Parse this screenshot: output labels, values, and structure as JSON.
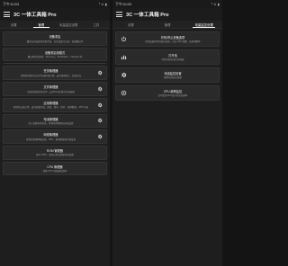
{
  "left": {
    "status": {
      "time": "下午10:53",
      "right": "⁰ ⊙ ▮"
    },
    "app_title": "3C 一体工具箱 Pro",
    "tabs": [
      "设置",
      "管理",
      "电量监控设置",
      "工具"
    ],
    "cards": [
      {
        "title": "设备重启",
        "desc": "重新启动设备并还原系统，包括设备冷启动、强制重启等"
      },
      {
        "title": "设备重启到模式",
        "desc": "重启到指定模式：Recovery、Bootloader、Fastboot 等"
      },
      {
        "title": "任务管理器",
        "desc": "查看和管理正在运行的进程和应用，支持强制停止、结束任务"
      },
      {
        "title": "文件管理器",
        "desc": "浏览和管理系统文件，支持Root权限访问和编辑"
      },
      {
        "title": "应用管理器",
        "desc": "管理已安装应用，支持批量冻结、卸载、备份、恢复、清理数据、APK 导出"
      },
      {
        "title": "电池管理器",
        "desc": "深入查看电池状态，管理电池健康和充电设置"
      },
      {
        "title": "网络管理器",
        "desc": "查看和管理网络连接、WiFi、移动数据和代理设置"
      },
      {
        "title": "ROM 管理器",
        "desc": "刷写 ROM、备份分区和管理系统镜像"
      },
      {
        "title": "CPU 管理器",
        "desc": "调整 CPU 调速器和频率"
      }
    ]
  },
  "right": {
    "status": {
      "time": "下午10:53",
      "right": "⁰ ⊙ ▮"
    },
    "app_title": "3C 一体工具箱 Pro",
    "tabs": [
      "设置",
      "管理",
      "电量监控设置"
    ],
    "cards": [
      {
        "icon": "power-icon",
        "title": "开机/停止设备选项",
        "desc": "控制设备开关机相关选项，包括 WiFi 唤醒、蓝牙唤醒等"
      },
      {
        "icon": "battery-chart-icon",
        "title": "打开电",
        "desc": "打开系统电池信息面板"
      },
      {
        "icon": "settings-icon",
        "title": "电池监控设置",
        "desc": "配置电池监控参数"
      },
      {
        "icon": "cpu-icon",
        "title": "CPU 频率监控",
        "desc": "实时监控CPU运行状态和频率"
      }
    ]
  },
  "colors": {
    "background": "#1e1e1e",
    "card": "#2a2a2a",
    "accent": "#ffffff"
  }
}
